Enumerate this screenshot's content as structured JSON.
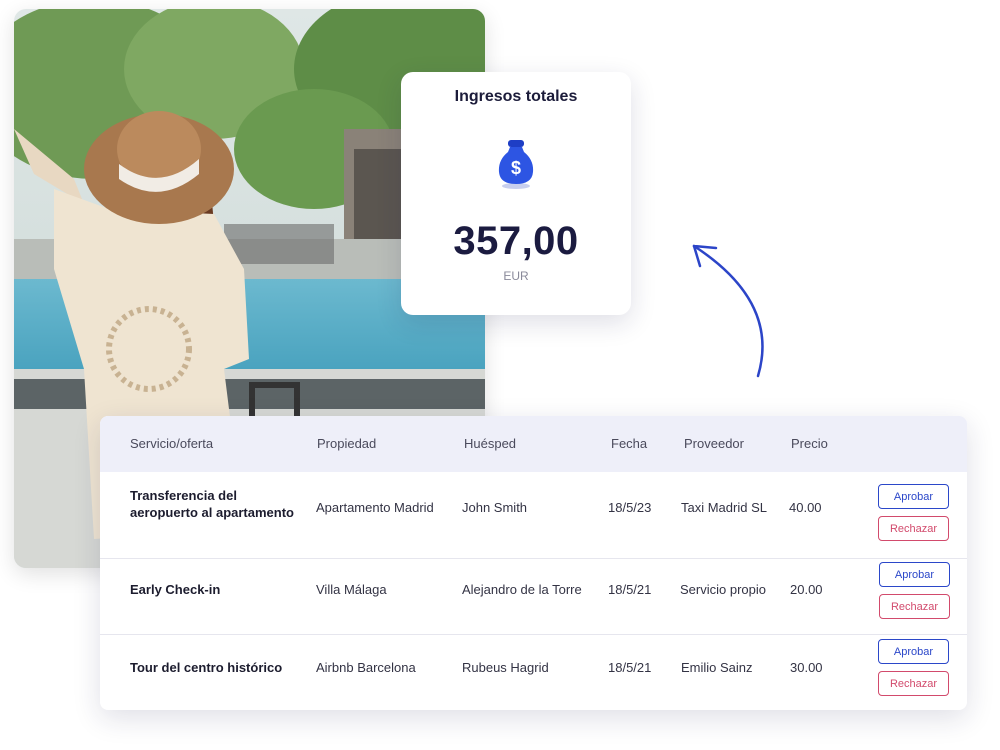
{
  "revenue": {
    "title": "Ingresos totales",
    "icon": "money-bag-icon",
    "amount": "357,00",
    "currency": "EUR"
  },
  "table": {
    "headers": [
      "Servicio/oferta",
      "Propiedad",
      "Huésped",
      "Fecha",
      "Proveedor",
      "Precio"
    ],
    "rows": [
      {
        "service": "Transferencia del aeropuerto al apartamento",
        "property": "Apartamento Madrid",
        "guest": "John Smith",
        "date": "18/5/23",
        "provider": "Taxi Madrid SL",
        "price": "40.00"
      },
      {
        "service": "Early Check-in",
        "property": "Villa Málaga",
        "guest": "Alejandro de la Torre",
        "date": "18/5/21",
        "provider": "Servicio propio",
        "price": "20.00"
      },
      {
        "service": "Tour del centro histórico",
        "property": "Airbnb Barcelona",
        "guest": "Rubeus Hagrid",
        "date": "18/5/21",
        "provider": "Emilio Sainz",
        "price": "30.00"
      }
    ],
    "approve_label": "Aprobar",
    "reject_label": "Rechazar"
  },
  "colors": {
    "accent": "#2b47c9",
    "reject": "#d24a6c",
    "header_bg": "#eeeff9"
  }
}
